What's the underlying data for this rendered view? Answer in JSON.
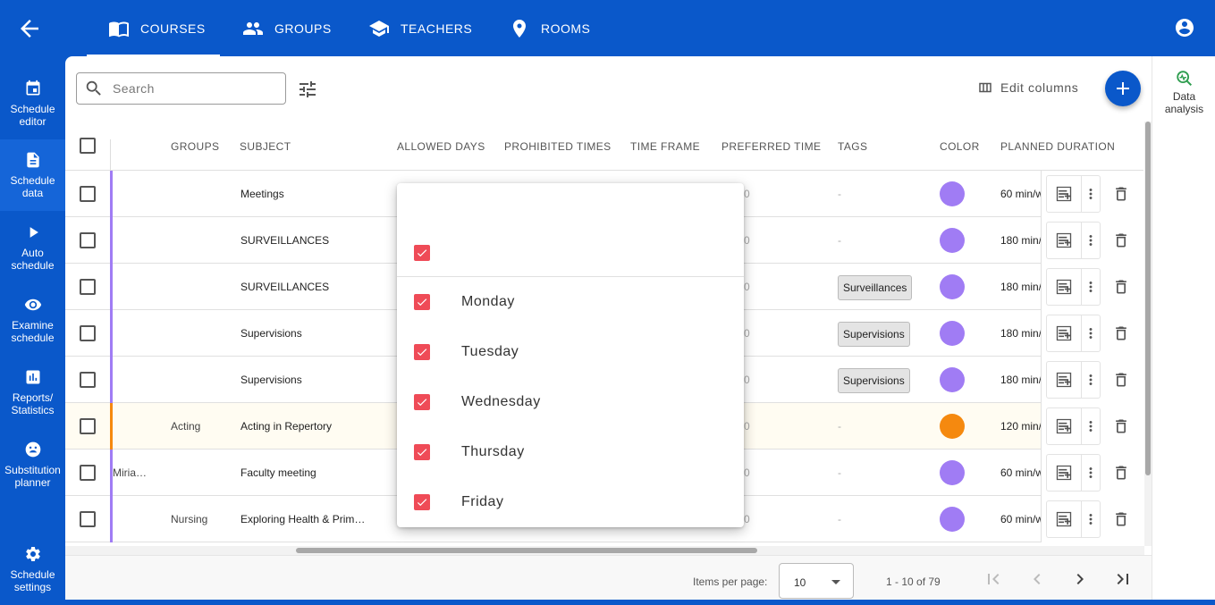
{
  "tabs": [
    {
      "label": "COURSES",
      "icon": "book-open-icon"
    },
    {
      "label": "GROUPS",
      "icon": "people-icon"
    },
    {
      "label": "TEACHERS",
      "icon": "school-icon"
    },
    {
      "label": "ROOMS",
      "icon": "location-pin-icon"
    }
  ],
  "sidebar": {
    "items": [
      {
        "label": "Schedule editor",
        "icon": "calendar-icon"
      },
      {
        "label": "Schedule data",
        "icon": "document-icon"
      },
      {
        "label": "Auto schedule",
        "icon": "play-icon"
      },
      {
        "label": "Examine schedule",
        "icon": "eye-icon"
      },
      {
        "label": "Reports/ Statistics",
        "icon": "chart-icon"
      },
      {
        "label": "Substitution planner",
        "icon": "sick-face-icon"
      },
      {
        "label": "Schedule settings",
        "icon": "gear-icon"
      }
    ]
  },
  "right_panel": {
    "label": "Data analysis",
    "icon": "analytics-icon"
  },
  "toolbar": {
    "search_placeholder": "Search",
    "edit_columns": "Edit columns"
  },
  "columns": [
    "GROUPS",
    "SUBJECT",
    "ALLOWED DAYS",
    "PROHIBITED TIMES",
    "TIME FRAME",
    "PREFERRED TIME",
    "TAGS",
    "COLOR",
    "PLANNED DURATION"
  ],
  "rows": [
    {
      "teacher": "",
      "group": "",
      "subject": "Meetings",
      "preferred": "0",
      "tag": "",
      "tags_empty": "-",
      "color": "#a07cf4",
      "bar": "#a07cf4",
      "duration": "60 min/w"
    },
    {
      "teacher": "",
      "group": "",
      "subject": "SURVEILLANCES",
      "preferred": "0",
      "tag": "",
      "tags_empty": "-",
      "color": "#a07cf4",
      "bar": "#a07cf4",
      "duration": "180 min/w"
    },
    {
      "teacher": "",
      "group": "",
      "subject": "SURVEILLANCES",
      "preferred": "0",
      "tag": "Surveillances",
      "tags_empty": "",
      "color": "#a07cf4",
      "bar": "#a07cf4",
      "duration": "180 min/w"
    },
    {
      "teacher": "",
      "group": "",
      "subject": "Supervisions",
      "preferred": "0",
      "tag": "Supervisions",
      "tags_empty": "",
      "color": "#a07cf4",
      "bar": "#a07cf4",
      "duration": "180 min/w"
    },
    {
      "teacher": "",
      "group": "",
      "subject": "Supervisions",
      "preferred": "0",
      "tag": "Supervisions",
      "tags_empty": "",
      "color": "#a07cf4",
      "bar": "#a07cf4",
      "duration": "180 min/w"
    },
    {
      "teacher": "",
      "group": "Acting",
      "subject": "Acting in Repertory",
      "preferred": "0",
      "tag": "",
      "tags_empty": "-",
      "color": "#f5890f",
      "bar": "#f5890f",
      "duration": "120 min/w"
    },
    {
      "teacher": "Miria…",
      "group": "",
      "subject": "Faculty meeting",
      "preferred": "0",
      "tag": "",
      "tags_empty": "-",
      "color": "#a07cf4",
      "bar": "#a07cf4",
      "duration": "60 min/w"
    },
    {
      "teacher": "",
      "group": "Nursing",
      "subject": "Exploring Health & Prim…",
      "preferred": "0",
      "tag": "",
      "tags_empty": "-",
      "color": "#a07cf4",
      "bar": "#a07cf4",
      "duration": "60 min/w"
    }
  ],
  "popup": {
    "days": [
      "Monday",
      "Tuesday",
      "Wednesday",
      "Thursday",
      "Friday"
    ]
  },
  "footer": {
    "items_per_page_label": "Items per page:",
    "items_per_page": "10",
    "range": "1 - 10 of 79"
  }
}
